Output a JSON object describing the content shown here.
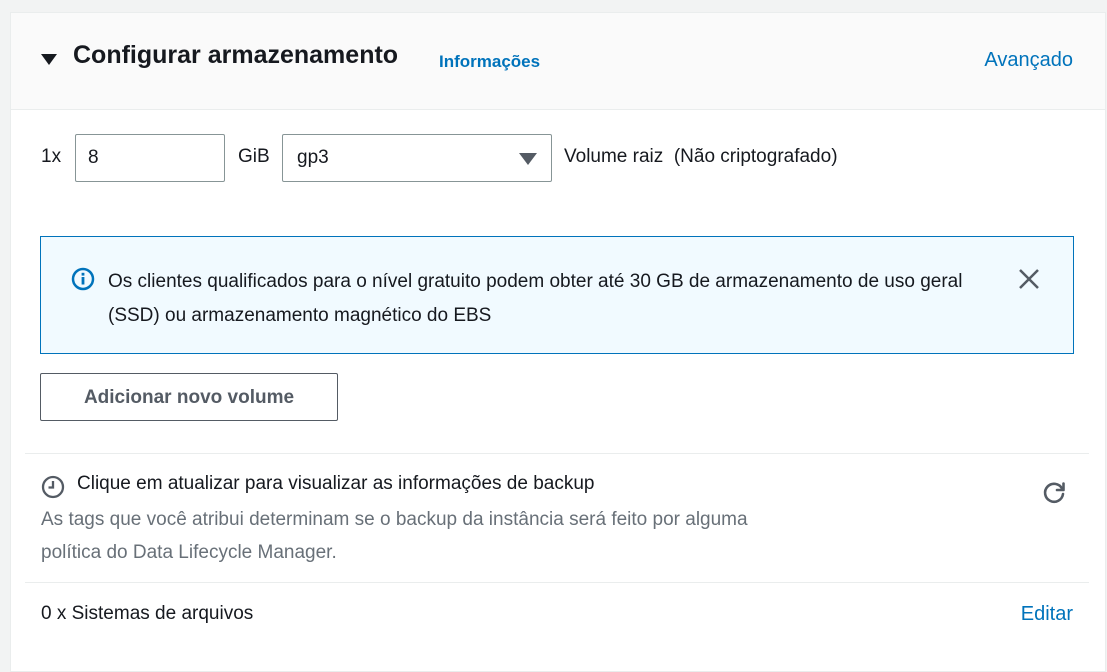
{
  "header": {
    "title": "Configurar armazenamento",
    "info_link": "Informações",
    "advanced_link": "Avançado"
  },
  "volume": {
    "multiplier": "1x",
    "size_value": "8",
    "unit": "GiB",
    "type_selected": "gp3",
    "description": "Volume raiz  (Não criptografado)"
  },
  "alert": {
    "icon": "info-icon",
    "text": "Os clientes qualificados para o nível gratuito podem obter até 30 GB de armazenamento de uso geral (SSD) ou armazenamento magnético do EBS"
  },
  "add_volume_label": "Adicionar novo volume",
  "backup": {
    "icon": "clock-icon",
    "title": "Clique em atualizar para visualizar as informações de backup",
    "description": "As tags que você atribui determinam se o backup da instância será feito por alguma política do Data Lifecycle Manager.",
    "refresh_icon": "refresh-icon"
  },
  "file_systems": {
    "label": "0 x Sistemas de arquivos",
    "edit_link": "Editar"
  },
  "colors": {
    "link": "#0073bb",
    "alert_bg": "#f1faff",
    "alert_border": "#0073bb",
    "muted_text": "#687078"
  }
}
